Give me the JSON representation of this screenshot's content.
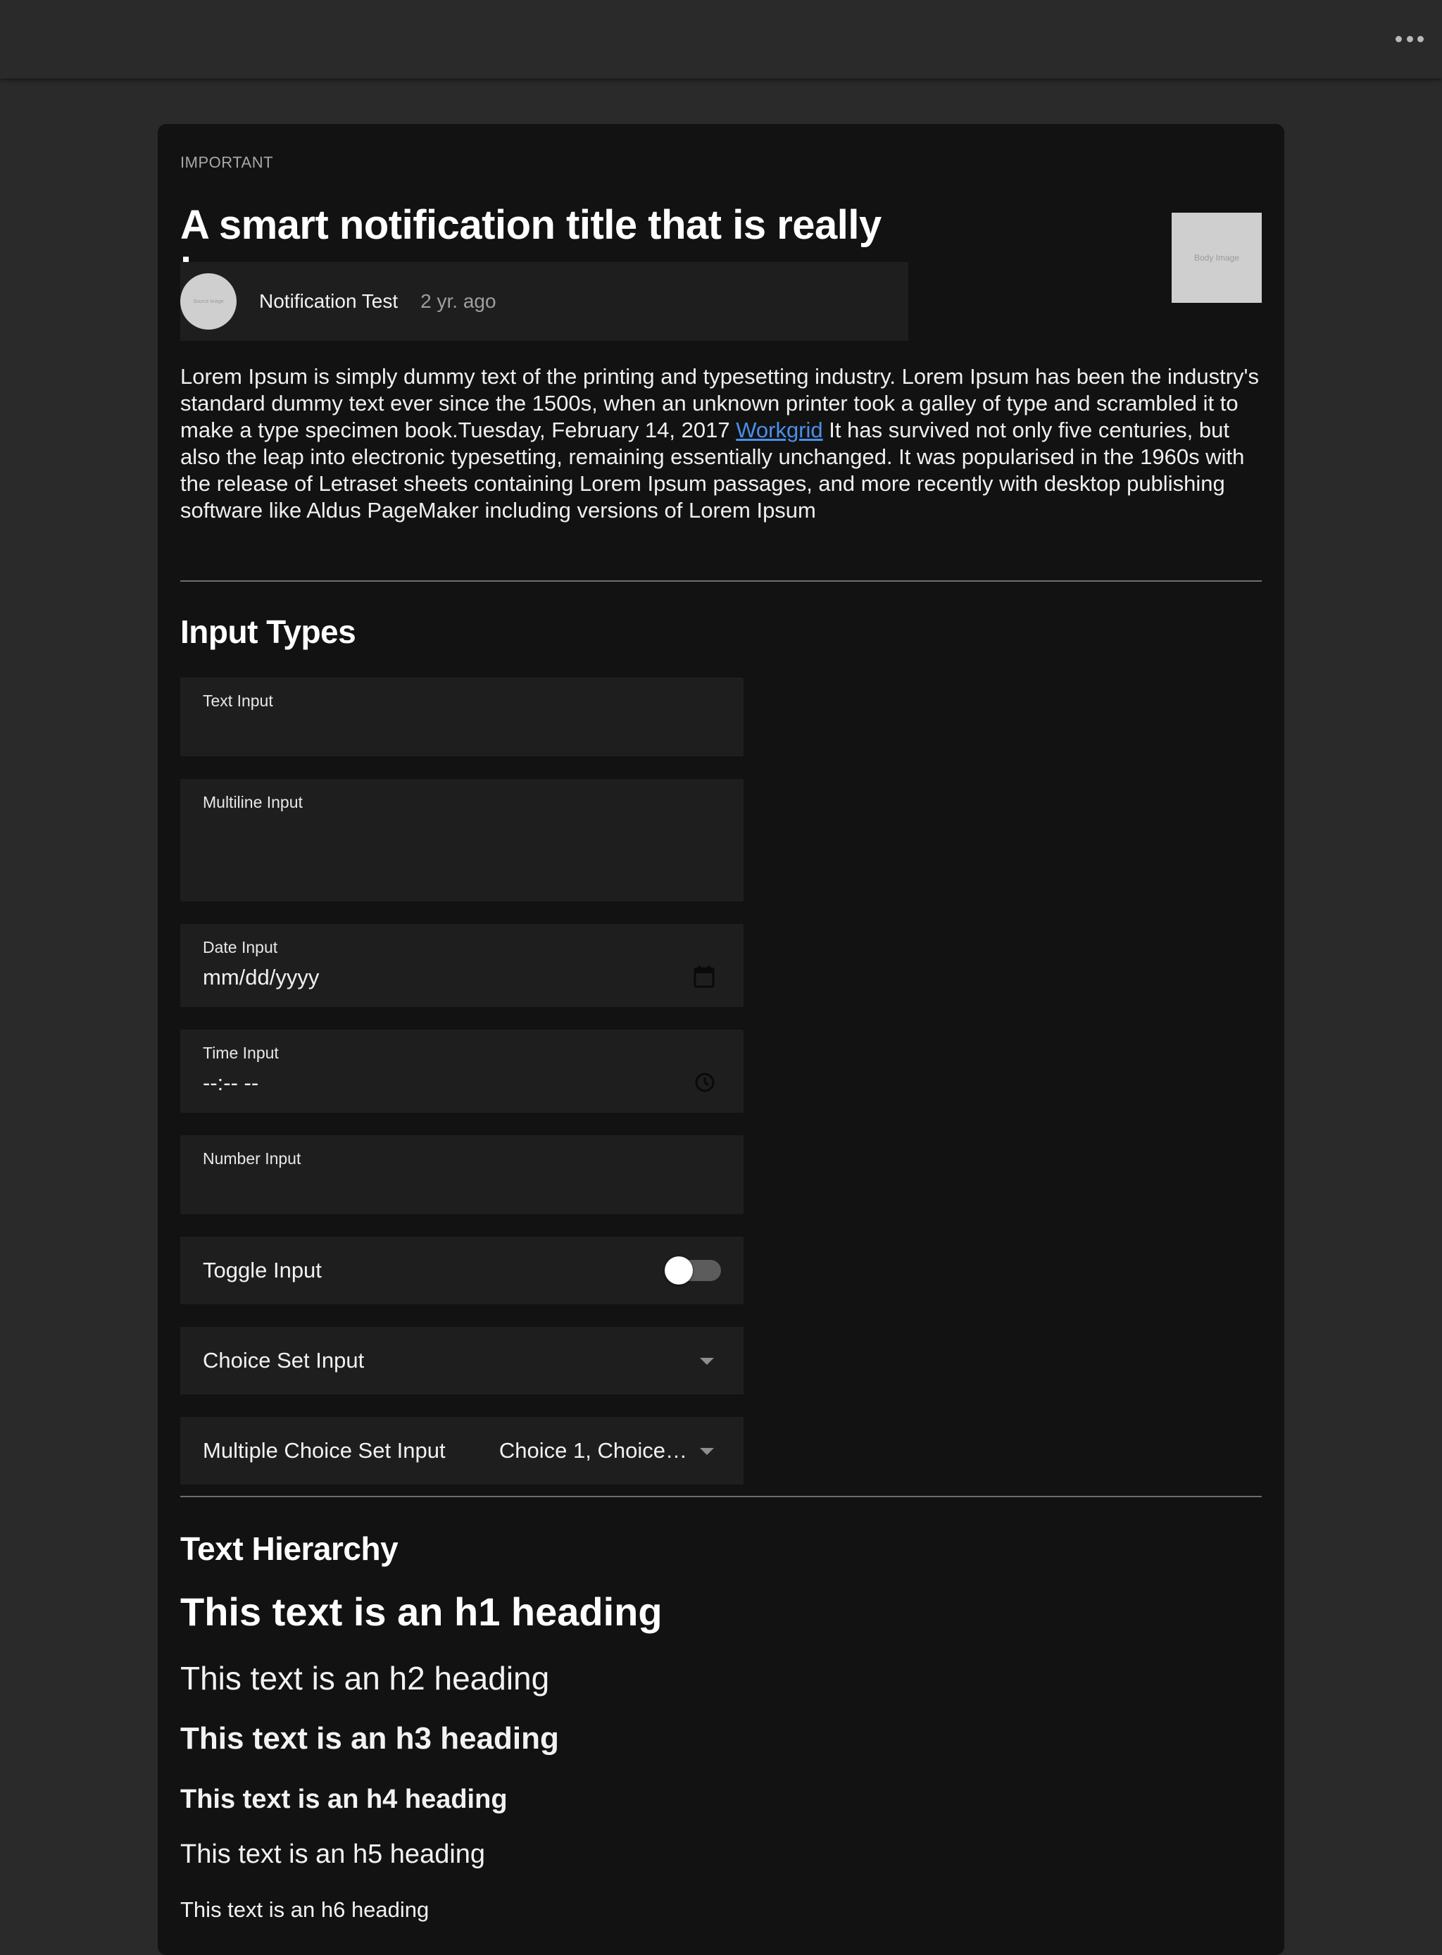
{
  "topbar": {
    "more_icon": "more-horizontal-icon"
  },
  "notification": {
    "eyebrow": "IMPORTANT",
    "title": "A smart notification title that is really long",
    "body_image_text": "Body Image",
    "avatar_text": "Source Image",
    "source_name": "Notification Test",
    "source_time": "2 yr. ago",
    "body_before_link": "Lorem Ipsum is simply dummy text of the printing and typesetting industry. Lorem Ipsum has been the industry's standard dummy text ever since the 1500s, when an unknown printer took a galley of type and scrambled it to make a type specimen book.Tuesday, February 14, 2017 ",
    "body_link": "Workgrid",
    "body_after_link": " It has survived not only five centuries, but also the leap into electronic typesetting, remaining essentially unchanged. It was popularised in the 1960s with the release of Letraset sheets containing Lorem Ipsum passages, and more recently with desktop publishing software like Aldus PageMaker including versions of Lorem Ipsum"
  },
  "inputs": {
    "section_title": "Input Types",
    "text_label": "Text Input",
    "multiline_label": "Multiline Input",
    "date_label": "Date Input",
    "date_placeholder": "mm/dd/yyyy",
    "time_label": "Time Input",
    "time_placeholder": "--:-- --",
    "number_label": "Number Input",
    "toggle_label": "Toggle Input",
    "toggle_on": false,
    "choice_label": "Choice Set Input",
    "multi_choice_label": "Multiple Choice Set Input",
    "multi_choice_value": "Choice 1, Choice…"
  },
  "hierarchy": {
    "section_title": "Text Hierarchy",
    "h1": "This text is an h1 heading",
    "h2": "This text is an h2 heading",
    "h3": "This text is an h3 heading",
    "h4": "This text is an h4 heading",
    "h5": "This text is an h5 heading",
    "h6": "This text is an h6 heading"
  },
  "colors": {
    "page_bg": "#2a2a2a",
    "card_bg": "#121212",
    "field_bg": "#1e1e1e",
    "link": "#4a8fe8"
  }
}
